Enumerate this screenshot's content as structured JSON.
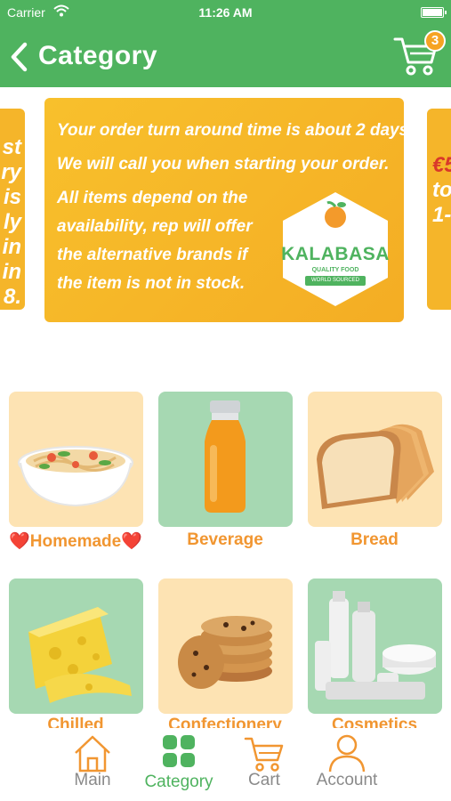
{
  "status_bar": {
    "carrier": "Carrier",
    "time": "11:26 AM"
  },
  "nav": {
    "title": "Category",
    "cart_count": "3"
  },
  "banner": {
    "lines": [
      "Your order turn around time is about 2 days.",
      "We will call you when starting your order.",
      "All items depend on the",
      "availability, rep will offer",
      "the alternative brands if",
      "the item is not in stock."
    ],
    "logo_name": "KALABASA",
    "logo_tagline": "QUALITY FOOD",
    "logo_ribbon": "WORLD SOURCED",
    "left_peek": [
      "st",
      "ry",
      "is",
      "ly",
      "in",
      "in",
      "8."
    ],
    "right_peek": [
      "€5",
      "to",
      "1-"
    ]
  },
  "categories": [
    {
      "label": "❤️Homemade❤️",
      "icon": "noodle-bowl-icon"
    },
    {
      "label": "Beverage",
      "icon": "juice-bottle-icon"
    },
    {
      "label": "Bread",
      "icon": "bread-loaf-icon"
    },
    {
      "label": "Chilled",
      "icon": "cheese-icon"
    },
    {
      "label": "Confectionery",
      "icon": "cookies-icon"
    },
    {
      "label": "Cosmetics",
      "icon": "cosmetics-icon"
    }
  ],
  "tabs": [
    {
      "label": "Main",
      "icon": "home-icon"
    },
    {
      "label": "Category",
      "icon": "grid-icon"
    },
    {
      "label": "Cart",
      "icon": "cart-icon"
    },
    {
      "label": "Account",
      "icon": "person-icon"
    }
  ],
  "colors": {
    "brand_green": "#4fb35f",
    "accent_orange": "#f19631",
    "banner_yellow": "#f6b529"
  }
}
